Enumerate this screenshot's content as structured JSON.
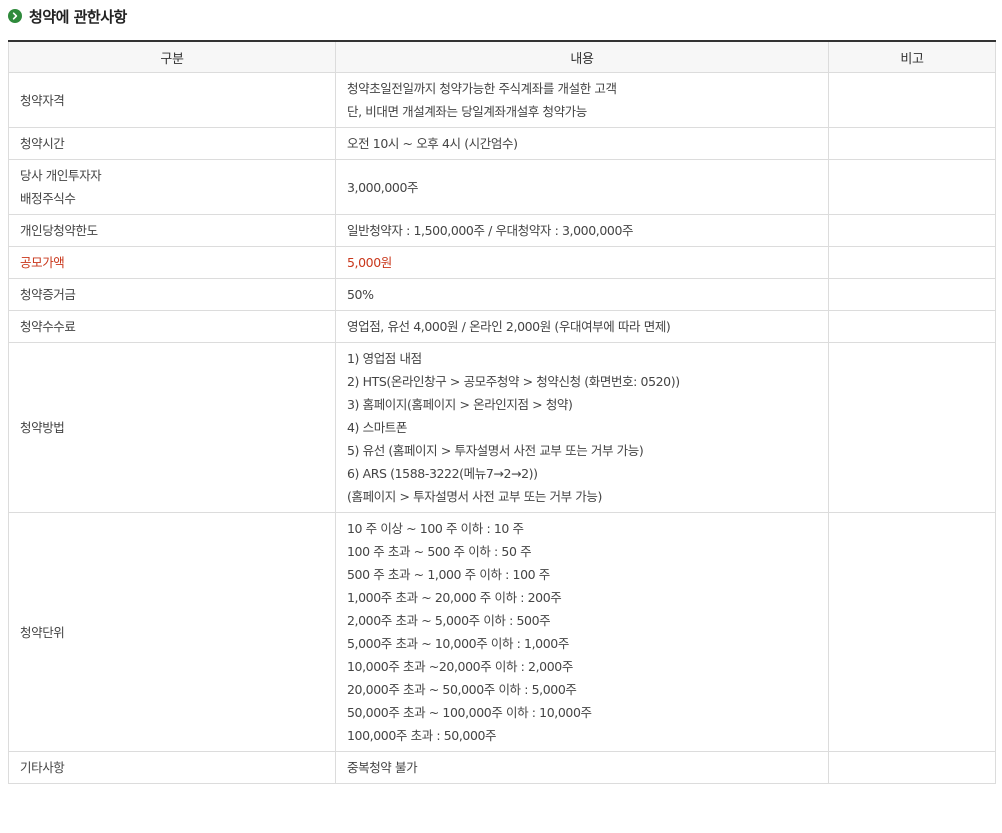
{
  "section": {
    "title": "청약에 관한사항",
    "icon": "chevron-right-icon",
    "icon_color": "#2f8a3c"
  },
  "table": {
    "headers": [
      "구분",
      "내용",
      "비고"
    ],
    "highlight_color": "#c9371b",
    "rows": [
      {
        "label": [
          "청약자격"
        ],
        "content": [
          "청약초일전일까지 청약가능한 주식계좌를 개설한 고객",
          "단, 비대면 개설계좌는 당일계좌개설후 청약가능"
        ],
        "note": ""
      },
      {
        "label": [
          "청약시간"
        ],
        "content": [
          "오전 10시 ~ 오후 4시 (시간엄수)"
        ],
        "note": ""
      },
      {
        "label": [
          "당사 개인투자자",
          "배정주식수"
        ],
        "content": [
          "3,000,000주"
        ],
        "note": ""
      },
      {
        "label": [
          "개인당청약한도"
        ],
        "content": [
          "일반청약자 : 1,500,000주 / 우대청약자 : 3,000,000주"
        ],
        "note": ""
      },
      {
        "label": [
          "공모가액"
        ],
        "content": [
          "5,000원"
        ],
        "note": "",
        "highlight": true
      },
      {
        "label": [
          "청약증거금"
        ],
        "content": [
          "50%"
        ],
        "note": ""
      },
      {
        "label": [
          "청약수수료"
        ],
        "content": [
          "영업점, 유선 4,000원 / 온라인 2,000원 (우대여부에 따라 면제)"
        ],
        "note": ""
      },
      {
        "label": [
          "청약방법"
        ],
        "content": [
          "1) 영업점 내점",
          "2) HTS(온라인창구 > 공모주청약 > 청약신청 (화면번호: 0520))",
          "3) 홈페이지(홈페이지 > 온라인지점 > 청약)",
          "4) 스마트폰",
          "5) 유선 (홈페이지 > 투자설명서 사전 교부 또는 거부 가능)",
          "6) ARS (1588-3222(메뉴7→2→2))",
          " (홈페이지 > 투자설명서 사전 교부 또는 거부 가능)"
        ],
        "note": ""
      },
      {
        "label": [
          "청약단위"
        ],
        "content": [
          "10 주 이상 ~ 100 주 이하 : 10 주",
          "100 주 초과 ~ 500 주 이하 : 50 주",
          "500 주 초과 ~ 1,000 주 이하 : 100 주",
          "1,000주 초과 ~ 20,000 주 이하 : 200주",
          "2,000주 초과 ~ 5,000주 이하 : 500주",
          "5,000주 초과 ~ 10,000주 이하 : 1,000주",
          "10,000주 초과 ~20,000주 이하 : 2,000주",
          "20,000주 초과 ~ 50,000주 이하 : 5,000주",
          "50,000주 초과 ~ 100,000주 이하 : 10,000주",
          "100,000주 초과 : 50,000주"
        ],
        "note": ""
      },
      {
        "label": [
          "기타사항"
        ],
        "content": [
          "중복청약 불가"
        ],
        "note": ""
      }
    ]
  }
}
